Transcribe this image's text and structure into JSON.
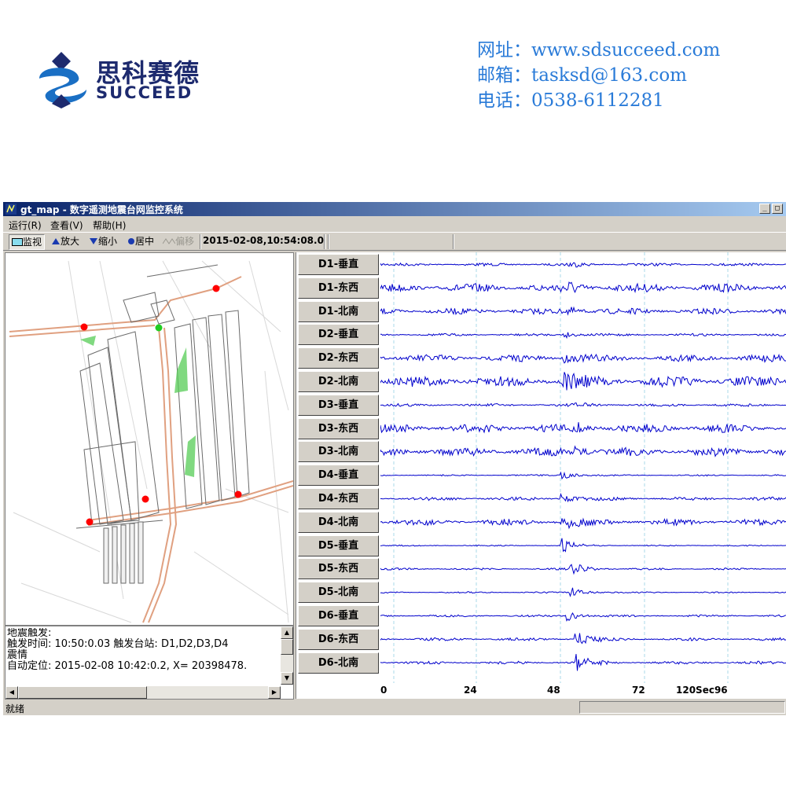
{
  "brand": {
    "name_cn": "思科赛德",
    "name_en": "SUCCEED",
    "colors": {
      "navy": "#1d2a6e",
      "blue": "#1a6fc4",
      "contact_blue": "#2a7bd8"
    }
  },
  "contacts": [
    {
      "label": "网址：",
      "value": "www.sdsucceed.com"
    },
    {
      "label": "邮箱：",
      "value": "tasksd@163.com"
    },
    {
      "label": "电话：",
      "value": "0538-6112281"
    }
  ],
  "window": {
    "title": "gt_map - 数字遥测地震台网监控系统",
    "title_icon": "app-icon",
    "controls": [
      "minimize",
      "maximize"
    ]
  },
  "menu": [
    {
      "label": "运行(R)"
    },
    {
      "label": "查看(V)"
    },
    {
      "label": "帮助(H)"
    }
  ],
  "toolbar": {
    "monitor": "监视",
    "zoom_in": "放大",
    "zoom_out": "缩小",
    "center": "居中",
    "offset": "偏移",
    "datetime": "2015-02-08,10:54:08.0"
  },
  "map": {
    "station_colors": {
      "active": "#ff0000",
      "idle": "#22cc22"
    },
    "road_color": "#e0a080",
    "building_color": "#55cc55"
  },
  "log": {
    "lines": [
      "地震触发:",
      "触发时间: 10:50:0.03 触发台站: D1,D2,D3,D4",
      "震情",
      "自动定位: 2015-02-08 10:42:0.2, X= 20398478."
    ]
  },
  "waveform": {
    "channels": [
      "D1-垂直",
      "D1-东西",
      "D1-北南",
      "D2-垂直",
      "D2-东西",
      "D2-北南",
      "D3-垂直",
      "D3-东西",
      "D3-北南",
      "D4-垂直",
      "D4-东西",
      "D4-北南",
      "D5-垂直",
      "D5-东西",
      "D5-北南",
      "D6-垂直",
      "D6-东西",
      "D6-北南"
    ],
    "trace_color": "#0000cc",
    "grid_color": "#a8d8e8",
    "x_ticks": [
      "0",
      "24",
      "48",
      "72",
      "120Sec96"
    ]
  },
  "status": {
    "text": "就绪"
  }
}
